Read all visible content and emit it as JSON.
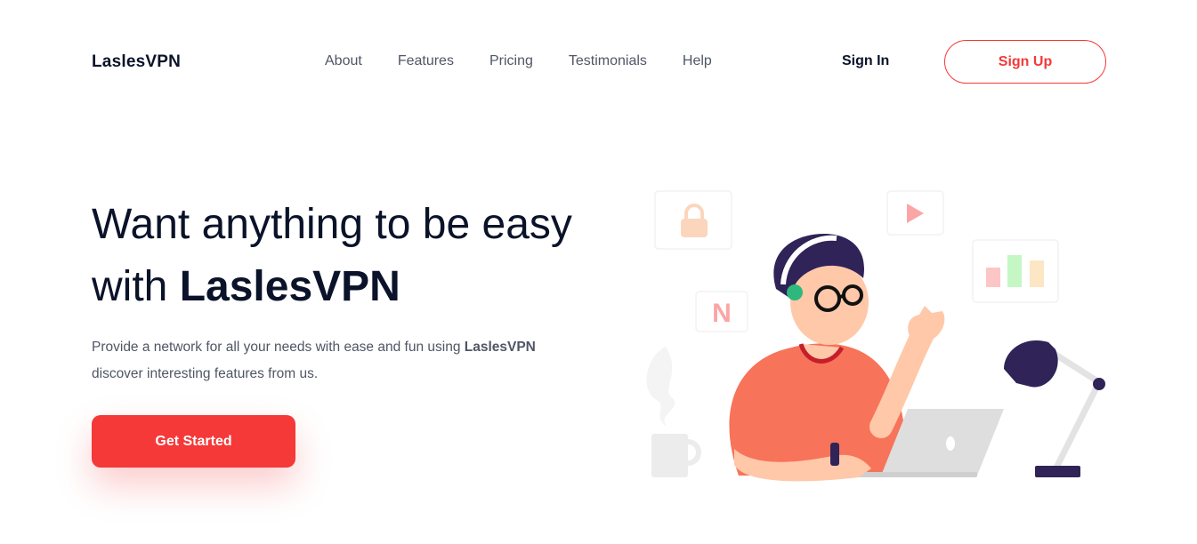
{
  "brand": {
    "name": "LaslesVPN"
  },
  "nav": {
    "items": [
      {
        "label": "About"
      },
      {
        "label": "Features"
      },
      {
        "label": "Pricing"
      },
      {
        "label": "Testimonials"
      },
      {
        "label": "Help"
      }
    ]
  },
  "auth": {
    "signin_label": "Sign In",
    "signup_label": "Sign Up"
  },
  "hero": {
    "headline_part1": "Want anything to be easy with",
    "headline_brand": "LaslesVPN",
    "sub_part1": "Provide a network for all your needs with ease and fun using",
    "sub_brand": "LaslesVPN",
    "sub_part2": "discover interesting features from us.",
    "cta_label": "Get Started"
  },
  "illustration": {
    "netflix_letter": "N",
    "icons": [
      "lock-icon",
      "play-icon",
      "bar-chart-icon",
      "netflix-icon",
      "coffee-mug-icon",
      "desk-lamp-icon",
      "laptop-icon"
    ]
  },
  "colors": {
    "accent": "#f53838",
    "text_dark": "#0b132a",
    "text_muted": "#4f5665",
    "shirt": "#f7735a",
    "hair": "#2f2357"
  }
}
